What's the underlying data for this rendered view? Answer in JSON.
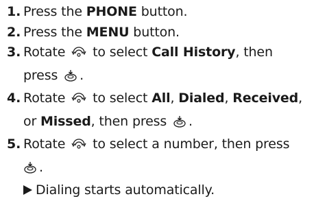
{
  "steps": [
    {
      "number": "1.",
      "before": "Press the ",
      "bold": "PHONE",
      "after": " button."
    },
    {
      "number": "2.",
      "before": "Press the ",
      "bold": "MENU",
      "after": " button."
    },
    {
      "number": "3.",
      "rotate": "Rotate",
      "select": "to select",
      "bold": "Call History",
      "after": ", then",
      "press": "press",
      "end": "."
    },
    {
      "number": "4.",
      "rotate": "Rotate",
      "select": "to select",
      "opt1": "All",
      "comma1": ",",
      "opt2": "Dialed",
      "comma2": ",",
      "opt3": "Received",
      "comma3": ",",
      "or": "or",
      "opt4": "Missed",
      "then_press": ", then press",
      "end": "."
    },
    {
      "number": "5.",
      "rotate": "Rotate",
      "select_rest": "to select a number, then press",
      "end": "."
    }
  ],
  "result": "Dialing starts automatically.",
  "icons": {
    "rotate": "interface-dial-rotate-icon",
    "press": "interface-dial-press-icon",
    "result": "result-arrow-icon"
  }
}
